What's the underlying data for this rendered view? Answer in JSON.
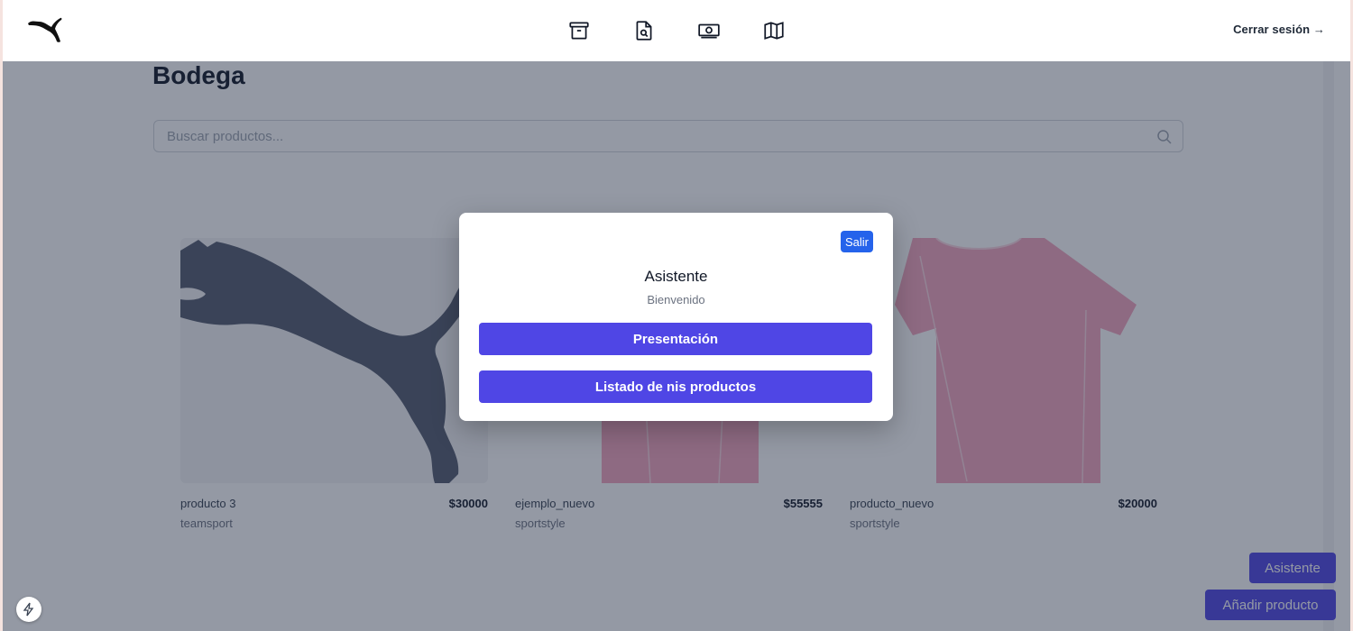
{
  "header": {
    "logo_icon": "puma-logo-icon",
    "nav": [
      {
        "icon": "archive-box-icon"
      },
      {
        "icon": "document-search-icon"
      },
      {
        "icon": "banknotes-icon"
      },
      {
        "icon": "map-icon"
      }
    ],
    "logout_label": "Cerrar sesión →"
  },
  "main": {
    "title": "Bodega",
    "search": {
      "placeholder": "Buscar productos...",
      "value": "",
      "icon": "search-icon"
    },
    "products": [
      {
        "name": "producto 3",
        "price": "$30000",
        "brand": "teamsport",
        "image_icon": "puma-cat-image"
      },
      {
        "name": "ejemplo_nuevo",
        "price": "$55555",
        "brand": "sportstyle",
        "image_icon": "pink-tshirt-image"
      },
      {
        "name": "producto_nuevo",
        "price": "$20000",
        "brand": "sportstyle",
        "image_icon": "pink-tshirt-image"
      }
    ],
    "assistant_button": "Asistente",
    "add_product_button": "Añadir producto",
    "dev_badge_icon": "bolt-icon"
  },
  "modal": {
    "close_label": "Salir",
    "title": "Asistente",
    "subtitle": "Bienvenido",
    "buttons": [
      "Presentación",
      "Listado de nis productos"
    ]
  },
  "colors": {
    "primary": "#4f46e5",
    "close_button": "#2563eb",
    "overlay": "#1f2940",
    "tshirt": "#f3a6be"
  }
}
